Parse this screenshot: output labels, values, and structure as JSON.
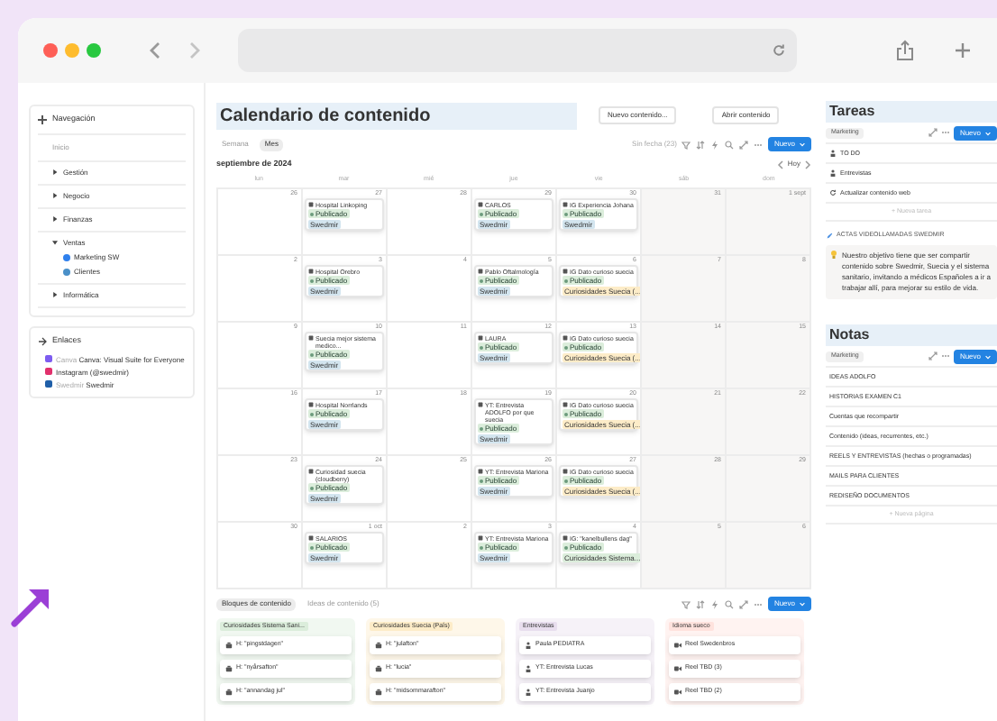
{
  "sidebar": {
    "nav_title": "Navegación",
    "home": "Inicio",
    "items": [
      {
        "label": "Gestión",
        "expanded": false
      },
      {
        "label": "Negocio",
        "expanded": false
      },
      {
        "label": "Finanzas",
        "expanded": false
      },
      {
        "label": "Ventas",
        "expanded": true,
        "children": [
          {
            "label": "Marketing SW",
            "color": "#2f80ed"
          },
          {
            "label": "Clientes",
            "color": "#4a90c8"
          }
        ]
      },
      {
        "label": "Informática",
        "expanded": false
      }
    ],
    "links_title": "Enlaces",
    "links": [
      {
        "prefix": "Canva",
        "label": "Canva: Visual Suite for Everyone",
        "color": "#7d5cf0"
      },
      {
        "label": "Instagram (@swedmir)",
        "color": "#e1306c"
      },
      {
        "prefix": "Swedmir",
        "label": "Swedmir",
        "color": "#1f5fa8"
      }
    ]
  },
  "page": {
    "title": "Calendario de contenido",
    "buttons": [
      "Nuevo contenido...",
      "Abrir contenido"
    ],
    "views": [
      {
        "label": "Semana",
        "selected": false
      },
      {
        "label": "Mes",
        "selected": true
      }
    ],
    "undated": "Sin fecha (23)",
    "new_button": "Nuevo",
    "month": "septiembre de 2024",
    "today": "Hoy",
    "weekdays": [
      "lun",
      "mar",
      "mié",
      "jue",
      "vie",
      "sáb",
      "dom"
    ],
    "weeks": [
      [
        {
          "day": "26"
        },
        {
          "day": "27",
          "cards": [
            {
              "title": "Hospital Linkoping",
              "status": "Publicado",
              "tag": {
                "label": "Swedmir",
                "color": "#d3e5ef"
              }
            }
          ]
        },
        {
          "day": "28"
        },
        {
          "day": "29",
          "cards": [
            {
              "title": "CARLOS",
              "status": "Publicado",
              "tag": {
                "label": "Swedmir",
                "color": "#d3e5ef"
              }
            }
          ]
        },
        {
          "day": "30",
          "cards": [
            {
              "title": "IG Experiencia Johana",
              "status": "Publicado",
              "tag": {
                "label": "Swedmir",
                "color": "#d3e5ef"
              }
            }
          ]
        },
        {
          "day": "31"
        },
        {
          "day": "1 sept"
        }
      ],
      [
        {
          "day": "2"
        },
        {
          "day": "3",
          "cards": [
            {
              "title": "Hospital Orebro",
              "status": "Publicado",
              "tag": {
                "label": "Swedmir",
                "color": "#d3e5ef"
              }
            }
          ]
        },
        {
          "day": "4"
        },
        {
          "day": "5",
          "cards": [
            {
              "title": "Pablo Oftalmología",
              "status": "Publicado",
              "tag": {
                "label": "Swedmir",
                "color": "#d3e5ef"
              }
            }
          ]
        },
        {
          "day": "6",
          "cards": [
            {
              "title": "IG Dato curioso suecia",
              "status": "Publicado",
              "tag": {
                "label": "Curiosidades Suecia (...",
                "color": "#fdecc8"
              }
            }
          ]
        },
        {
          "day": "7"
        },
        {
          "day": "8"
        }
      ],
      [
        {
          "day": "9"
        },
        {
          "day": "10",
          "cards": [
            {
              "title": "Suecia mejor sistema medico...",
              "status": "Publicado",
              "tag": {
                "label": "Swedmir",
                "color": "#d3e5ef"
              }
            }
          ]
        },
        {
          "day": "11"
        },
        {
          "day": "12",
          "cards": [
            {
              "title": "LAURA",
              "status": "Publicado",
              "tag": {
                "label": "Swedmir",
                "color": "#d3e5ef"
              }
            }
          ]
        },
        {
          "day": "13",
          "cards": [
            {
              "title": "IG Dato curioso suecia",
              "status": "Publicado",
              "tag": {
                "label": "Curiosidades Suecia (...",
                "color": "#fdecc8"
              }
            }
          ]
        },
        {
          "day": "14"
        },
        {
          "day": "15"
        }
      ],
      [
        {
          "day": "16"
        },
        {
          "day": "17",
          "cards": [
            {
              "title": "Hospital Norrlands",
              "status": "Publicado",
              "tag": {
                "label": "Swedmir",
                "color": "#d3e5ef"
              }
            }
          ]
        },
        {
          "day": "18"
        },
        {
          "day": "19",
          "cards": [
            {
              "title": "YT: Entrevista ADOLFO por que suecia",
              "status": "Publicado",
              "tag": {
                "label": "Swedmir",
                "color": "#d3e5ef"
              }
            }
          ]
        },
        {
          "day": "20",
          "cards": [
            {
              "title": "IG Dato curioso suecia",
              "status": "Publicado",
              "tag": {
                "label": "Curiosidades Suecia (...",
                "color": "#fdecc8"
              }
            }
          ]
        },
        {
          "day": "21"
        },
        {
          "day": "22"
        }
      ],
      [
        {
          "day": "23"
        },
        {
          "day": "24",
          "cards": [
            {
              "title": "Curiosidad suecia (cloudberry)",
              "status": "Publicado",
              "tag": {
                "label": "Swedmir",
                "color": "#d3e5ef"
              }
            }
          ]
        },
        {
          "day": "25"
        },
        {
          "day": "26",
          "cards": [
            {
              "title": "YT: Entrevista Mariona",
              "status": "Publicado",
              "tag": {
                "label": "Swedmir",
                "color": "#d3e5ef"
              }
            }
          ]
        },
        {
          "day": "27",
          "cards": [
            {
              "title": "IG Dato curioso suecia",
              "status": "Publicado",
              "tag": {
                "label": "Curiosidades Suecia (...",
                "color": "#fdecc8"
              }
            }
          ]
        },
        {
          "day": "28"
        },
        {
          "day": "29"
        }
      ],
      [
        {
          "day": "30"
        },
        {
          "day": "1 oct",
          "cards": [
            {
              "title": "SALARIOS",
              "status": "Publicado",
              "tag": {
                "label": "Swedmir",
                "color": "#d3e5ef"
              }
            }
          ]
        },
        {
          "day": "2"
        },
        {
          "day": "3",
          "cards": [
            {
              "title": "YT: Entrevista Mariona",
              "status": "Publicado",
              "tag": {
                "label": "Swedmir",
                "color": "#d3e5ef"
              }
            }
          ]
        },
        {
          "day": "4",
          "cards": [
            {
              "title": "IG: \"kanelbullens dag\"",
              "status": "Publicado",
              "tag": {
                "label": "Curiosidades Sistema...",
                "color": "#dbeddb"
              }
            }
          ]
        },
        {
          "day": "5"
        },
        {
          "day": "6"
        }
      ]
    ]
  },
  "board": {
    "tabs": [
      {
        "label": "Bloques de contenido",
        "selected": true
      },
      {
        "label": "Ideas de contenido (5)",
        "selected": false
      }
    ],
    "new_button": "Nuevo",
    "columns": [
      {
        "title": "Curiosidades Sistema Sani...",
        "color": "#dbeddb",
        "kind": "post",
        "cards": [
          "H: \"pingstdagen\"",
          "H: \"nyårsafton\"",
          "H: \"annandag jul\""
        ]
      },
      {
        "title": "Curiosidades Suecia (País)",
        "color": "#fdecc8",
        "kind": "post",
        "cards": [
          "H: \"julafton\"",
          "H: \"lucia\"",
          "H: \"midsommarafton\""
        ]
      },
      {
        "title": "Entrevistas",
        "color": "#e8deee",
        "kind": "person",
        "cards": [
          "Paula PEDIATRA",
          "YT: Entrevista Lucas",
          "YT: Entrevista Juanjo"
        ]
      },
      {
        "title": "Idioma sueco",
        "color": "#ffe2dd",
        "kind": "video",
        "cards": [
          "Reel Swedenbros",
          "Reel TBD (3)",
          "Reel TBD (2)"
        ]
      }
    ]
  },
  "tasks": {
    "title": "Tareas",
    "filter": "Marketing",
    "new_button": "Nuevo",
    "items": [
      {
        "label": "TO DO",
        "kind": "person"
      },
      {
        "label": "Entrevistas",
        "kind": "person"
      },
      {
        "label": "Actualizar contenido web",
        "kind": "sync"
      }
    ],
    "add": "+ Nueva tarea"
  },
  "minutes": "ACTAS VIDEOLLAMADAS SWEDMIR",
  "callout": "Nuestro objetivo tiene que ser compartir contenido sobre Swedmir, Suecia y el sistema sanitario, invitando a médicos Españoles a ir a trabajar allí, para mejorar su estilo de vida.",
  "notes": {
    "title": "Notas",
    "filter": "Marketing",
    "new_button": "Nuevo",
    "items": [
      "IDEAS ADOLFO",
      "HISTORIAS EXAMEN C1",
      "Cuentas que recompartir",
      "Contenido (ideas, recurrentes, etc.)",
      "REELS Y ENTREVISTAS (hechas o programadas)",
      "MAILS PARA CLIENTES",
      "REDISEÑO DOCUMENTOS"
    ],
    "add": "+ Nueva página"
  }
}
